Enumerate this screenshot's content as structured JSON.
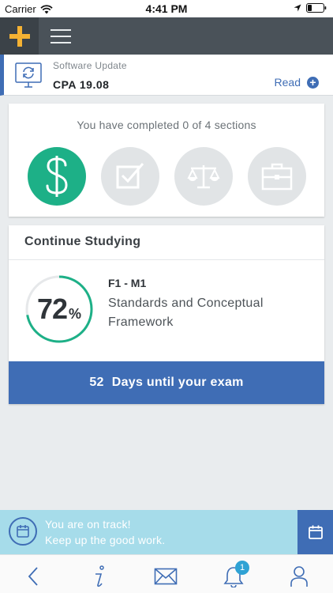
{
  "status_bar": {
    "carrier": "Carrier",
    "time": "4:41 PM"
  },
  "header": {
    "logo_icon": "plus-logo-icon",
    "menu_icon": "hamburger-menu-icon"
  },
  "software_update": {
    "label": "Software Update",
    "version": "CPA 19.08",
    "read_label": "Read",
    "icon": "monitor-sync-icon"
  },
  "progress": {
    "completed_text": "You have completed 0 of 4 sections",
    "sections": [
      {
        "icon": "dollar-icon",
        "active": true
      },
      {
        "icon": "checkbox-icon",
        "active": false
      },
      {
        "icon": "scales-icon",
        "active": false
      },
      {
        "icon": "briefcase-icon",
        "active": false
      }
    ]
  },
  "continue_studying": {
    "title": "Continue Studying",
    "percent_value": "72",
    "percent_unit": "%",
    "percent_fraction": 0.72,
    "module_code": "F1 - M1",
    "module_name": "Standards and Conceptual Framework",
    "days_value": "52",
    "days_label": "Days until your exam"
  },
  "track": {
    "line1": "You are on track!",
    "line2": "Keep up the good work."
  },
  "bottom_nav": {
    "notification_count": "1",
    "items": [
      "back-icon",
      "info-icon",
      "mail-icon",
      "bell-icon",
      "profile-icon"
    ]
  },
  "colors": {
    "accent_blue": "#3f6db5",
    "accent_green": "#1db087",
    "header_bg": "#4a5259",
    "logo_orange": "#f5b233",
    "track_bg": "#a6dcea"
  }
}
